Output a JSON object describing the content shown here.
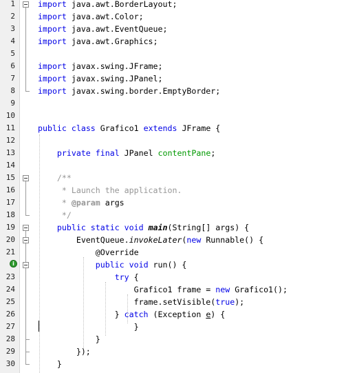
{
  "editor": {
    "lines": [
      {
        "n": "1",
        "tokens": [
          {
            "t": "import",
            "c": "kw"
          },
          {
            "t": " java.awt.BorderLayout;"
          }
        ]
      },
      {
        "n": "2",
        "tokens": [
          {
            "t": "import",
            "c": "kw"
          },
          {
            "t": " java.awt.Color;"
          }
        ]
      },
      {
        "n": "3",
        "tokens": [
          {
            "t": "import",
            "c": "kw"
          },
          {
            "t": " java.awt.EventQueue;"
          }
        ]
      },
      {
        "n": "4",
        "tokens": [
          {
            "t": "import",
            "c": "kw"
          },
          {
            "t": " java.awt.Graphics;"
          }
        ]
      },
      {
        "n": "5",
        "tokens": []
      },
      {
        "n": "6",
        "tokens": [
          {
            "t": "import",
            "c": "kw"
          },
          {
            "t": " javax.swing.JFrame;"
          }
        ]
      },
      {
        "n": "7",
        "tokens": [
          {
            "t": "import",
            "c": "kw"
          },
          {
            "t": " javax.swing.JPanel;"
          }
        ]
      },
      {
        "n": "8",
        "tokens": [
          {
            "t": "import",
            "c": "kw"
          },
          {
            "t": " javax.swing.border.EmptyBorder;"
          }
        ]
      },
      {
        "n": "9",
        "tokens": []
      },
      {
        "n": "10",
        "tokens": []
      },
      {
        "n": "11",
        "tokens": [
          {
            "t": "public",
            "c": "kw"
          },
          {
            "t": " "
          },
          {
            "t": "class",
            "c": "kw"
          },
          {
            "t": " Grafico1 "
          },
          {
            "t": "extends",
            "c": "kw"
          },
          {
            "t": " JFrame {"
          }
        ]
      },
      {
        "n": "12",
        "tokens": []
      },
      {
        "n": "13",
        "tokens": [
          {
            "t": "    "
          },
          {
            "t": "private",
            "c": "kw"
          },
          {
            "t": " "
          },
          {
            "t": "final",
            "c": "kw"
          },
          {
            "t": " JPanel "
          },
          {
            "t": "contentPane",
            "c": "fld"
          },
          {
            "t": ";"
          }
        ]
      },
      {
        "n": "14",
        "tokens": []
      },
      {
        "n": "15",
        "tokens": [
          {
            "t": "    "
          },
          {
            "t": "/**",
            "c": "cm"
          }
        ]
      },
      {
        "n": "16",
        "tokens": [
          {
            "t": "    "
          },
          {
            "t": " * Launch the application.",
            "c": "cm"
          }
        ]
      },
      {
        "n": "17",
        "tokens": [
          {
            "t": "    "
          },
          {
            "t": " * ",
            "c": "cm"
          },
          {
            "t": "@param",
            "c": "cmt"
          },
          {
            "t": " args"
          }
        ]
      },
      {
        "n": "18",
        "tokens": [
          {
            "t": "    "
          },
          {
            "t": " */",
            "c": "cm"
          }
        ]
      },
      {
        "n": "19",
        "tokens": [
          {
            "t": "    "
          },
          {
            "t": "public",
            "c": "kw"
          },
          {
            "t": " "
          },
          {
            "t": "static",
            "c": "kw"
          },
          {
            "t": " "
          },
          {
            "t": "void",
            "c": "kw"
          },
          {
            "t": " "
          },
          {
            "t": "main",
            "c": "bi"
          },
          {
            "t": "(String[] args) {"
          }
        ]
      },
      {
        "n": "20",
        "tokens": [
          {
            "t": "        EventQueue."
          },
          {
            "t": "invokeLater",
            "c": "it"
          },
          {
            "t": "("
          },
          {
            "t": "new",
            "c": "kw"
          },
          {
            "t": " Runnable() {"
          }
        ]
      },
      {
        "n": "21",
        "tokens": [
          {
            "t": "            "
          },
          {
            "t": "@Override",
            "c": "ann"
          }
        ]
      },
      {
        "n": "22",
        "tokens": [
          {
            "t": "            "
          },
          {
            "t": "public",
            "c": "kw"
          },
          {
            "t": " "
          },
          {
            "t": "void",
            "c": "kw"
          },
          {
            "t": " run() {"
          }
        ]
      },
      {
        "n": "23",
        "tokens": [
          {
            "t": "                "
          },
          {
            "t": "try",
            "c": "kw"
          },
          {
            "t": " {"
          }
        ]
      },
      {
        "n": "24",
        "tokens": [
          {
            "t": "                    Grafico1 frame = "
          },
          {
            "t": "new",
            "c": "kw"
          },
          {
            "t": " Grafico1();"
          }
        ]
      },
      {
        "n": "25",
        "tokens": [
          {
            "t": "                    frame.setVisible("
          },
          {
            "t": "true",
            "c": "kw"
          },
          {
            "t": ");"
          }
        ]
      },
      {
        "n": "26",
        "tokens": [
          {
            "t": "                } "
          },
          {
            "t": "catch",
            "c": "kw"
          },
          {
            "t": " (Exception "
          },
          {
            "t": "e",
            "c": "ul"
          },
          {
            "t": ") {"
          }
        ]
      },
      {
        "n": "27",
        "tokens": [
          {
            "t": "                    }"
          }
        ]
      },
      {
        "n": "28",
        "tokens": [
          {
            "t": "            }"
          }
        ]
      },
      {
        "n": "29",
        "tokens": [
          {
            "t": "        });"
          }
        ]
      },
      {
        "n": "30",
        "tokens": [
          {
            "t": "    }"
          }
        ]
      }
    ],
    "override_badge": "i",
    "colors": {
      "keyword": "#0000e6",
      "field": "#009900",
      "comment": "#969696"
    }
  }
}
